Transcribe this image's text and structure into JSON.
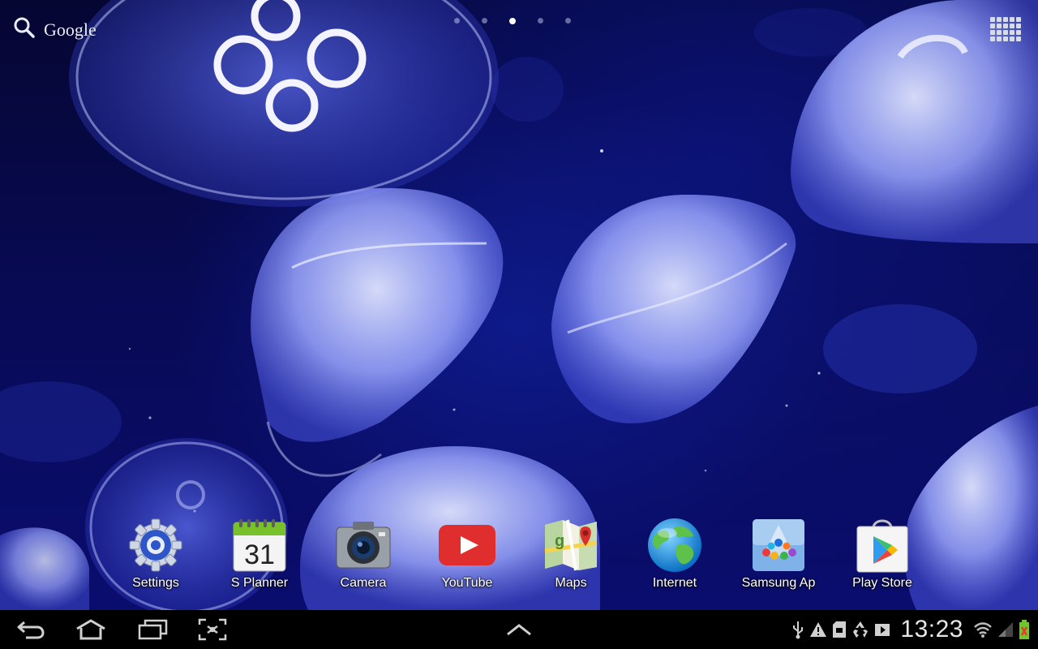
{
  "search": {
    "label": "Google"
  },
  "home_pages": {
    "count": 5,
    "active_index": 2
  },
  "dock": [
    {
      "label": "Settings",
      "icon": "settings-gear-icon"
    },
    {
      "label": "S Planner",
      "icon": "calendar-icon",
      "day": "31"
    },
    {
      "label": "Camera",
      "icon": "camera-icon"
    },
    {
      "label": "YouTube",
      "icon": "youtube-icon"
    },
    {
      "label": "Maps",
      "icon": "maps-icon"
    },
    {
      "label": "Internet",
      "icon": "globe-icon"
    },
    {
      "label": "Samsung Ap",
      "icon": "samsung-apps-icon"
    },
    {
      "label": "Play Store",
      "icon": "play-store-icon"
    }
  ],
  "system_bar": {
    "clock": "13:23",
    "nav": [
      "back-icon",
      "home-icon",
      "recent-apps-icon",
      "screenshot-icon",
      "expand-up-icon"
    ],
    "status_icons": [
      "usb-icon",
      "warning-icon",
      "sd-card-icon",
      "recycle-icon",
      "media-icon",
      "wifi-icon",
      "signal-icon",
      "battery-charging-icon"
    ]
  },
  "colors": {
    "wallpaper_deep": "#050632",
    "jellyfish": "#b8c4ff",
    "system_bar": "#000000",
    "youtube_red": "#e02d2d",
    "battery_green": "#6fc72a"
  }
}
